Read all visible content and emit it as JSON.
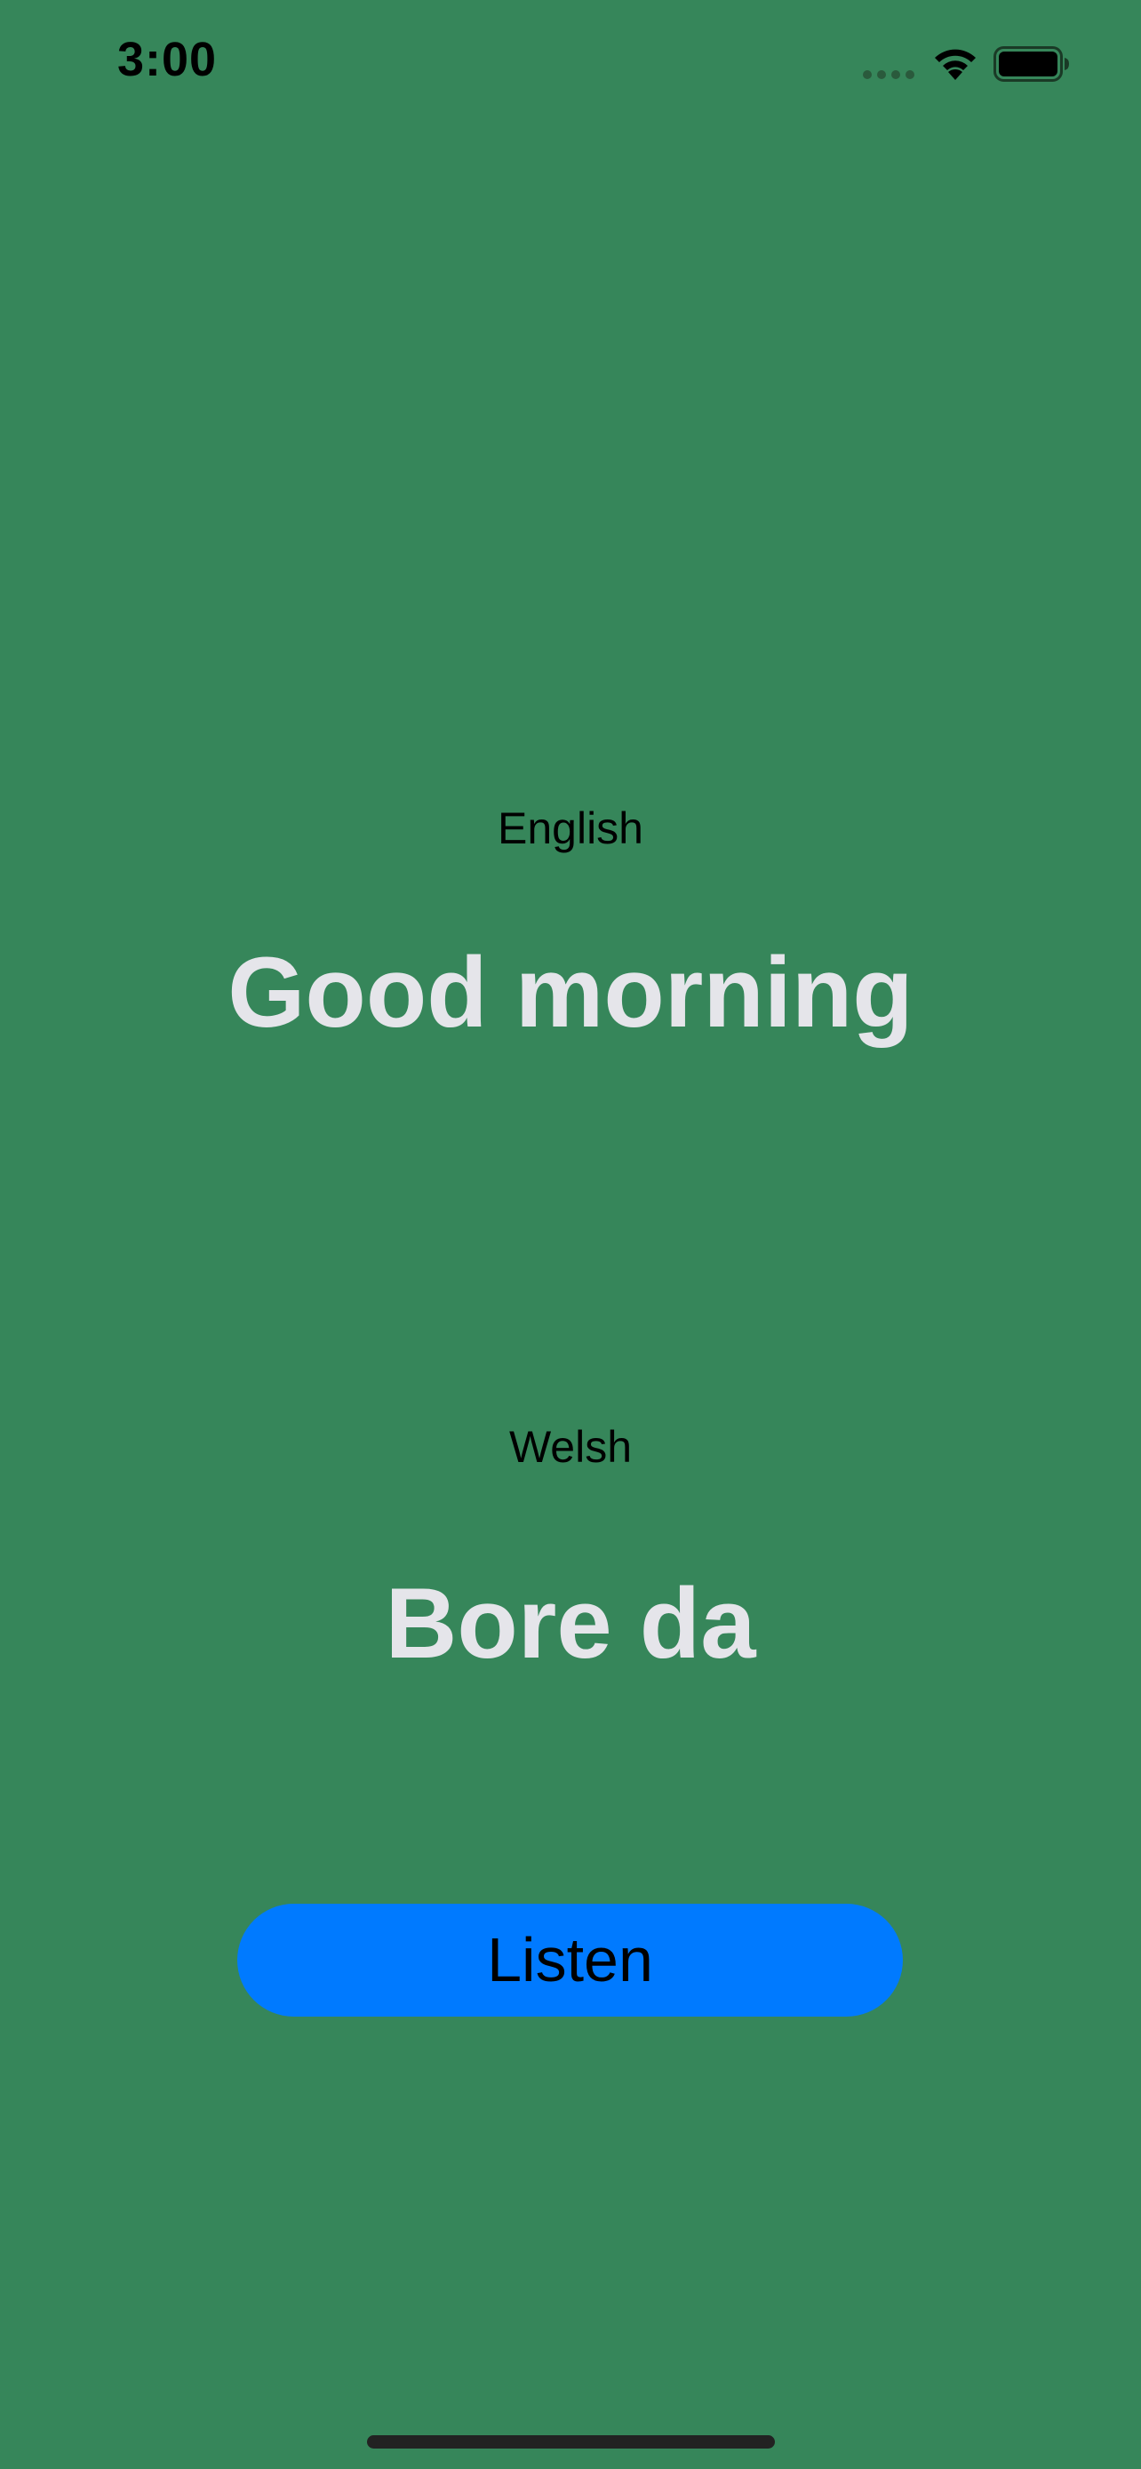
{
  "status_bar": {
    "time": "3:00",
    "signal_icon": "signal-dots-icon",
    "wifi_icon": "wifi-icon",
    "battery_icon": "battery-icon"
  },
  "source": {
    "language_label": "English",
    "phrase": "Good morning"
  },
  "target": {
    "language_label": "Welsh",
    "phrase": "Bore da"
  },
  "actions": {
    "listen_label": "Listen"
  },
  "colors": {
    "background": "#36865A",
    "phrase_text": "#E5E5EA",
    "button": "#007AFF"
  }
}
